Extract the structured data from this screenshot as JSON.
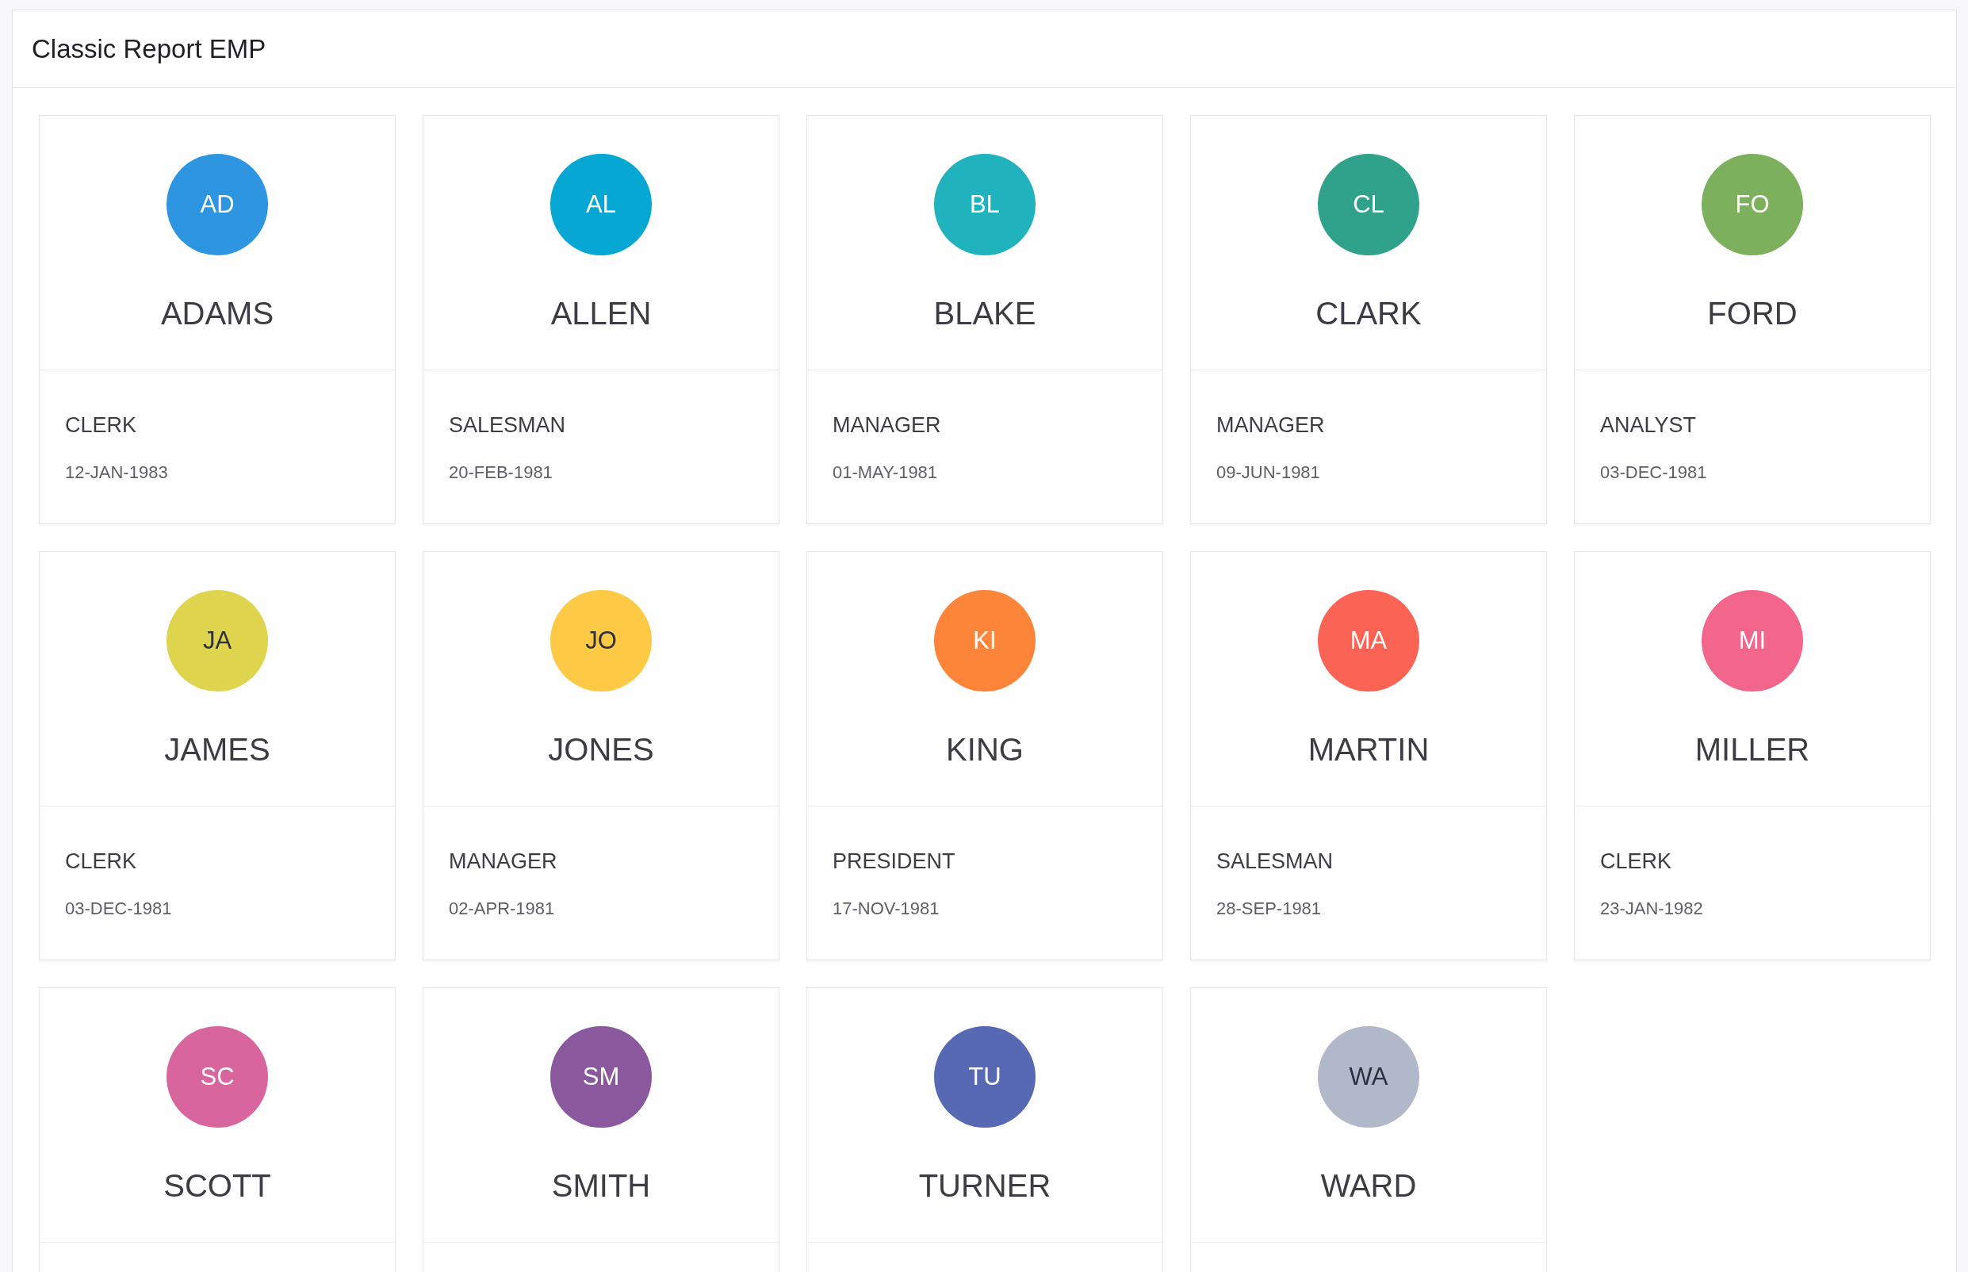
{
  "region": {
    "title": "Classic Report EMP"
  },
  "cards": [
    {
      "initials": "AD",
      "name": "ADAMS",
      "job": "CLERK",
      "hiredate": "12-JAN-1983",
      "color": "#2e95e0"
    },
    {
      "initials": "AL",
      "name": "ALLEN",
      "job": "SALESMAN",
      "hiredate": "20-FEB-1981",
      "color": "#07a7d3"
    },
    {
      "initials": "BL",
      "name": "BLAKE",
      "job": "MANAGER",
      "hiredate": "01-MAY-1981",
      "color": "#20b2bd"
    },
    {
      "initials": "CL",
      "name": "CLARK",
      "job": "MANAGER",
      "hiredate": "09-JUN-1981",
      "color": "#30a18a"
    },
    {
      "initials": "FO",
      "name": "FORD",
      "job": "ANALYST",
      "hiredate": "03-DEC-1981",
      "color": "#7cb05c"
    },
    {
      "initials": "JA",
      "name": "JAMES",
      "job": "CLERK",
      "hiredate": "03-DEC-1981",
      "color": "#dfd44d"
    },
    {
      "initials": "JO",
      "name": "JONES",
      "job": "MANAGER",
      "hiredate": "02-APR-1981",
      "color": "#fec944"
    },
    {
      "initials": "KI",
      "name": "KING",
      "job": "PRESIDENT",
      "hiredate": "17-NOV-1981",
      "color": "#fc853a"
    },
    {
      "initials": "MA",
      "name": "MARTIN",
      "job": "SALESMAN",
      "hiredate": "28-SEP-1981",
      "color": "#fb6455"
    },
    {
      "initials": "MI",
      "name": "MILLER",
      "job": "CLERK",
      "hiredate": "23-JAN-1982",
      "color": "#f2668c"
    },
    {
      "initials": "SC",
      "name": "SCOTT",
      "color": "#d8659e"
    },
    {
      "initials": "SM",
      "name": "SMITH",
      "color": "#8a589c"
    },
    {
      "initials": "TU",
      "name": "TURNER",
      "color": "#5769b3"
    },
    {
      "initials": "WA",
      "name": "WARD",
      "color": "#b0b8c9"
    }
  ]
}
